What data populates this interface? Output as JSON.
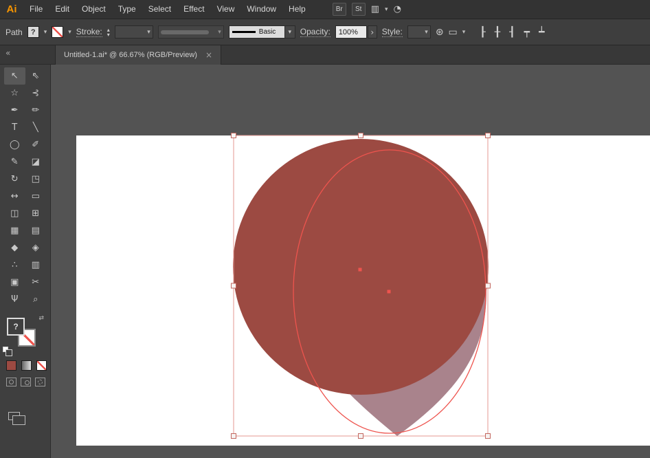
{
  "app": {
    "logo": "Ai"
  },
  "menubar": {
    "menus": [
      "File",
      "Edit",
      "Object",
      "Type",
      "Select",
      "Effect",
      "View",
      "Window",
      "Help"
    ],
    "bridge_label": "Br",
    "stock_label": "St"
  },
  "icons": {
    "chevron": "▾",
    "up": "▴",
    "close": "×",
    "collapse": "«",
    "arrange": "▥",
    "gauge": "◔",
    "recolor": "⊛",
    "transform": "▭",
    "expand": "›",
    "swap": "⇄"
  },
  "control_bar": {
    "context": "Path",
    "fill_placeholder": "?",
    "stroke_label": "Stroke:",
    "brush_name": "Basic",
    "opacity_label": "Opacity:",
    "opacity_value": "100%",
    "style_label": "Style:"
  },
  "tab": {
    "title": "Untitled-1.ai* @ 66.67% (RGB/Preview)"
  },
  "tools": [
    {
      "name": "selection-tool",
      "glyph": "↖",
      "active": true
    },
    {
      "name": "direct-selection-tool",
      "glyph": "⇖"
    },
    {
      "name": "magic-wand-tool",
      "glyph": "☆"
    },
    {
      "name": "lasso-tool",
      "glyph": "⊰"
    },
    {
      "name": "pen-tool",
      "glyph": "✒"
    },
    {
      "name": "curvature-tool",
      "glyph": "✏"
    },
    {
      "name": "type-tool",
      "glyph": "T"
    },
    {
      "name": "line-segment-tool",
      "glyph": "╲"
    },
    {
      "name": "ellipse-tool",
      "glyph": "◯"
    },
    {
      "name": "paintbrush-tool",
      "glyph": "✐"
    },
    {
      "name": "shaper-tool",
      "glyph": "✎"
    },
    {
      "name": "eraser-tool",
      "glyph": "◪"
    },
    {
      "name": "rotate-tool",
      "glyph": "↻"
    },
    {
      "name": "scale-tool",
      "glyph": "◳"
    },
    {
      "name": "width-tool",
      "glyph": "↔"
    },
    {
      "name": "free-transform-tool",
      "glyph": "▭"
    },
    {
      "name": "shape-builder-tool",
      "glyph": "◫"
    },
    {
      "name": "perspective-grid-tool",
      "glyph": "⊞"
    },
    {
      "name": "mesh-tool",
      "glyph": "▦"
    },
    {
      "name": "gradient-tool",
      "glyph": "▤"
    },
    {
      "name": "eyedropper-tool",
      "glyph": "◆"
    },
    {
      "name": "blend-tool",
      "glyph": "◈"
    },
    {
      "name": "symbol-sprayer-tool",
      "glyph": "∴"
    },
    {
      "name": "column-graph-tool",
      "glyph": "▥"
    },
    {
      "name": "artboard-tool",
      "glyph": "▣"
    },
    {
      "name": "slice-tool",
      "glyph": "✂"
    },
    {
      "name": "hand-tool",
      "glyph": "Ψ"
    },
    {
      "name": "zoom-tool",
      "glyph": "⌕"
    }
  ],
  "align_tools": [
    {
      "name": "align-horizontal-left-icon",
      "glyph": "┠"
    },
    {
      "name": "align-horizontal-center-icon",
      "glyph": "╂"
    },
    {
      "name": "align-horizontal-right-icon",
      "glyph": "┨"
    },
    {
      "name": "align-vertical-top-icon",
      "glyph": "┯"
    },
    {
      "name": "align-vertical-bottom-icon",
      "glyph": "┷"
    }
  ],
  "canvas": {
    "background": "#535353",
    "artboard": "#ffffff",
    "circle_color": "#9c4a42",
    "teardrop_color": "#a9838c",
    "selection_color": "#ee544e",
    "bbox_color": "#e59792",
    "handle_fill": "#f6f3f2",
    "handle_stroke": "#c2675f",
    "zoom_level": "66.67%",
    "color_mode": "RGB/Preview"
  }
}
